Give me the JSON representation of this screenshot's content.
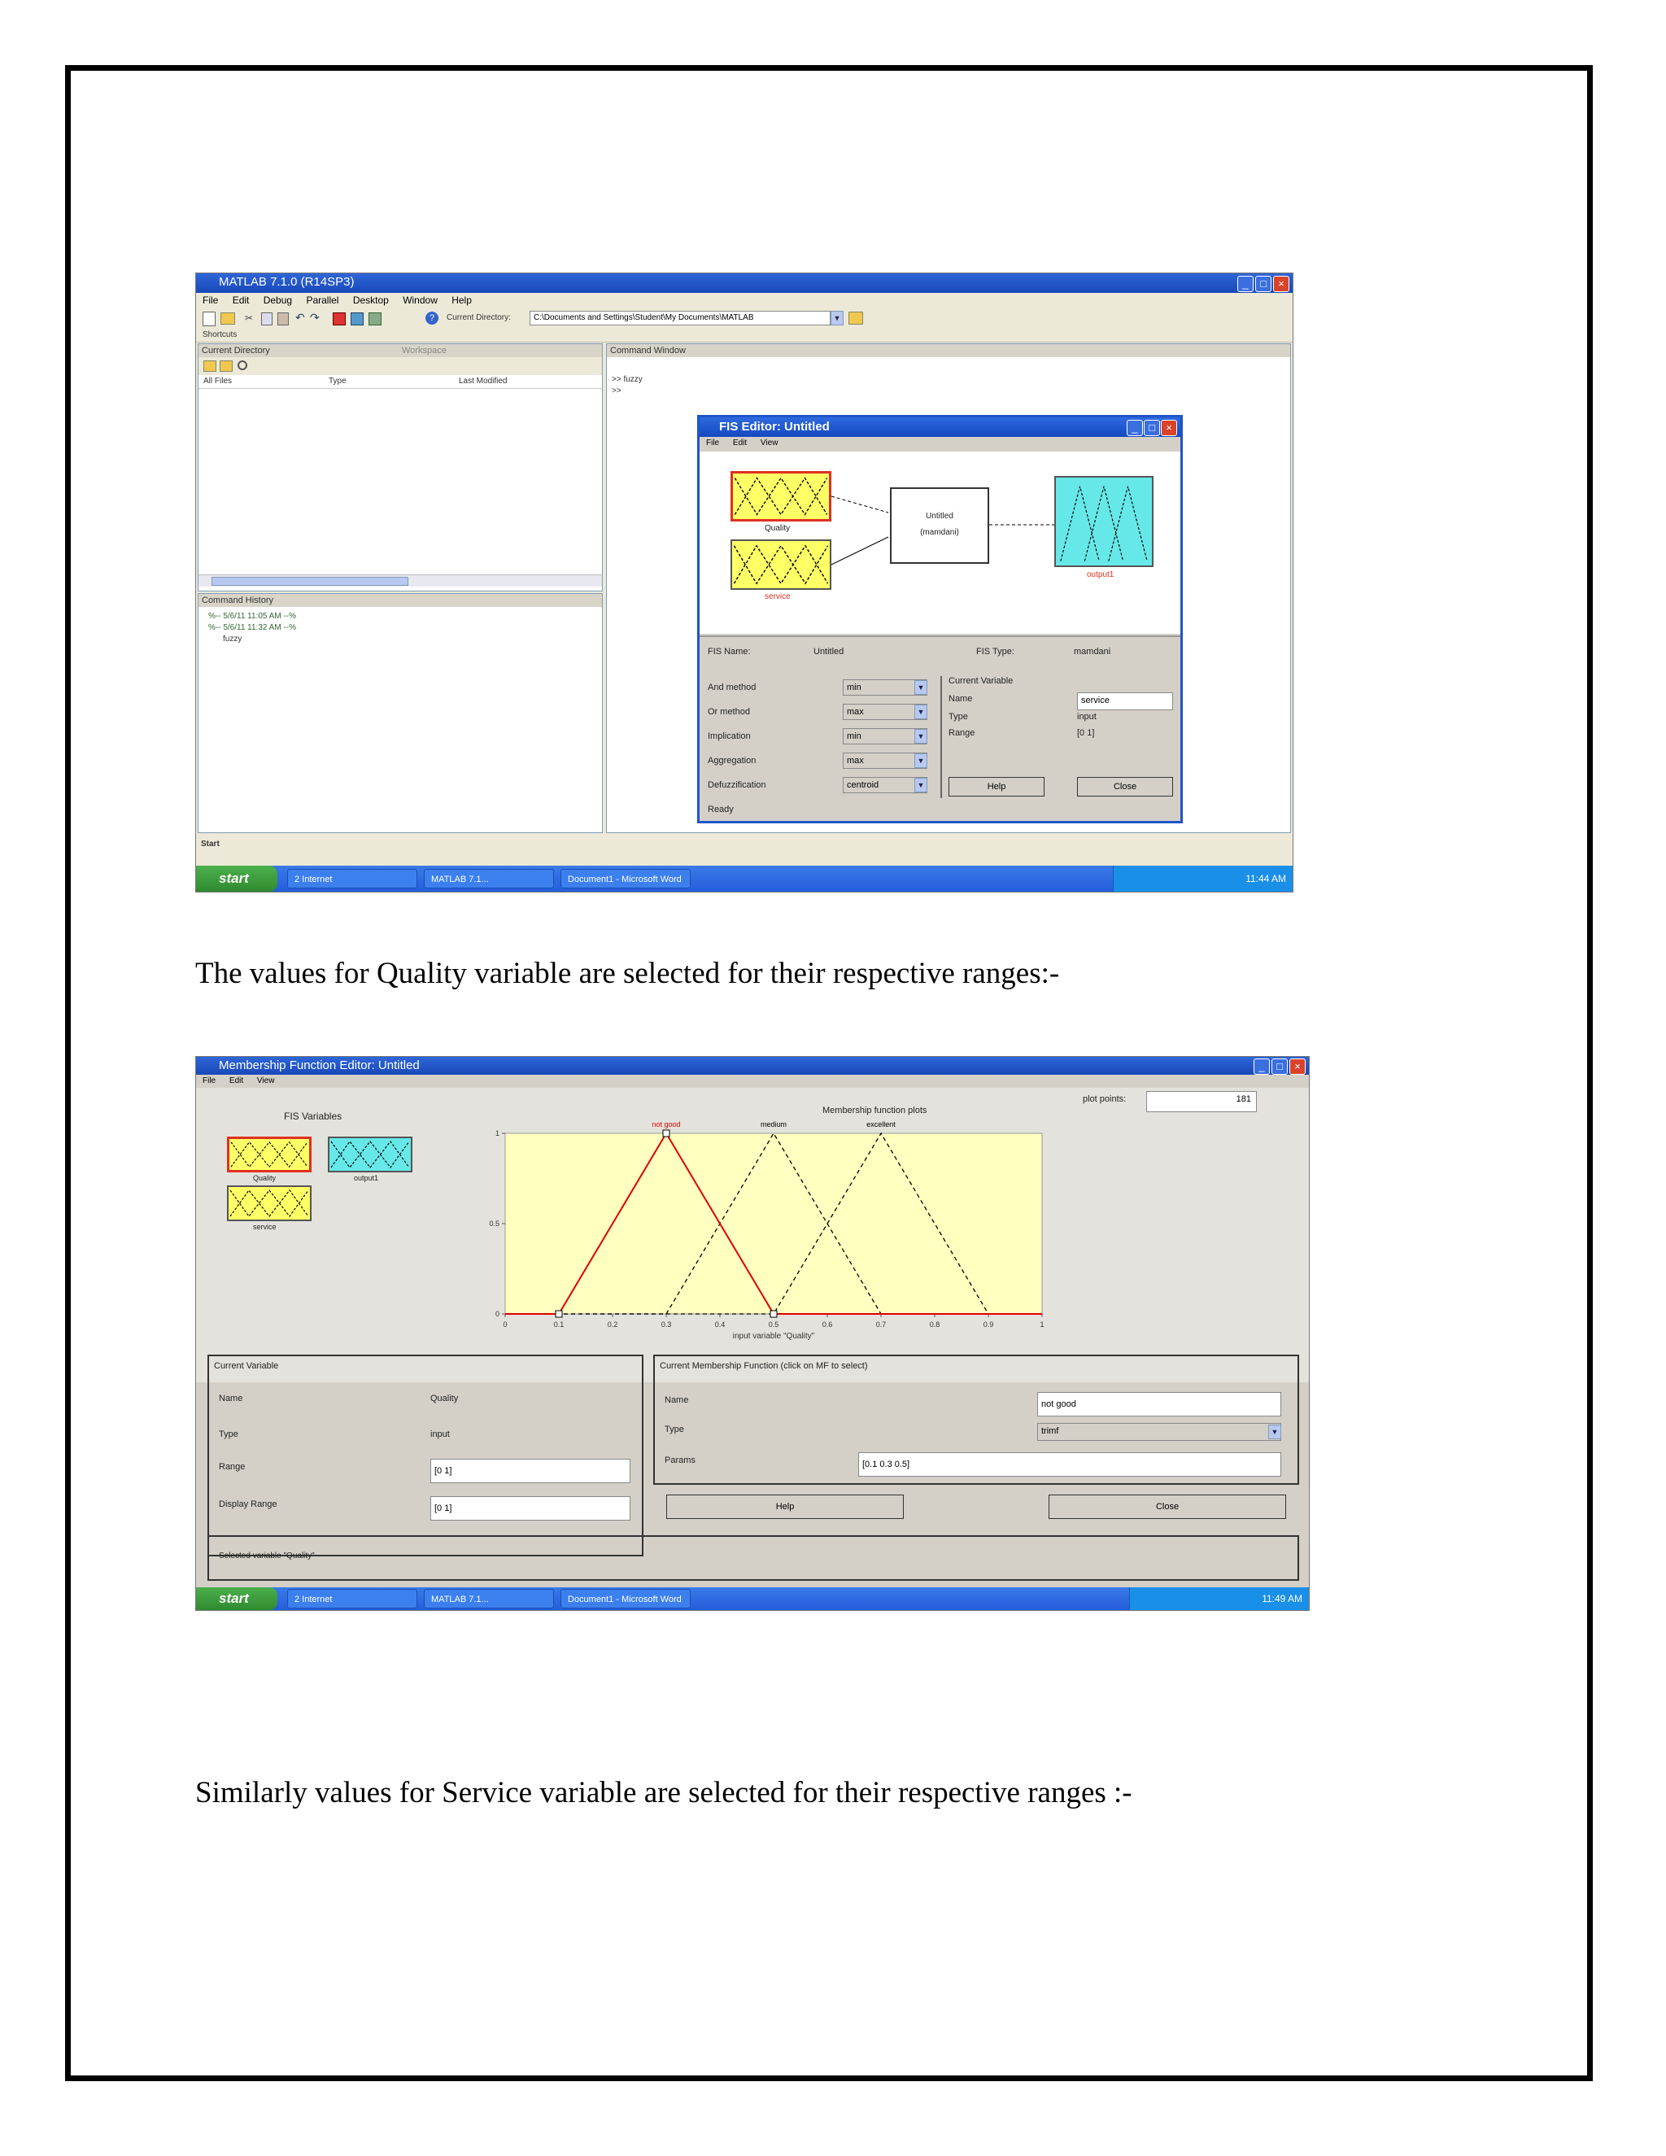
{
  "doc": {
    "caption1": "The values for Quality variable are selected for their respective ranges:-",
    "caption2": "Similarly values for Service variable are selected for their respective ranges :-"
  },
  "screenshot1": {
    "title": "MATLAB 7.1.0 (R14SP3)",
    "menu": [
      "File",
      "Edit",
      "Debug",
      "Parallel",
      "Desktop",
      "Window",
      "Help"
    ],
    "current_directory_label": "Current Directory:",
    "current_directory_path": "C:\\Documents and Settings\\Student\\My Documents\\MATLAB",
    "shortcuts_label": "Shortcuts",
    "panels": {
      "current_directory": "Current Directory",
      "workspace": "Workspace",
      "command_window": "Command Window",
      "command_history": "Command History"
    },
    "command_window_lines": [
      ">> fuzzy",
      ">>"
    ],
    "command_history_lines": [
      "%-- 5/6/11 11:05 AM --%",
      "%-- 5/6/11 11:32 AM --%",
      "fuzzy"
    ],
    "file_columns": [
      "All Files",
      "Type",
      "Last Modified"
    ],
    "status": "Start",
    "fis_editor": {
      "title": "FIS Editor: Untitled",
      "menu": [
        "File",
        "Edit",
        "View"
      ],
      "input1_label": "Quality",
      "input2_label": "service",
      "system_label_line1": "Untitled",
      "system_label_line2": "(mamdani)",
      "output_label": "output1",
      "fis_name_label": "FIS Name:",
      "fis_name_value": "Untitled",
      "fis_type_label": "FIS Type:",
      "fis_type_value": "mamdani",
      "rows": [
        {
          "label": "And method",
          "value": "min"
        },
        {
          "label": "Or method",
          "value": "max"
        },
        {
          "label": "Implication",
          "value": "min"
        },
        {
          "label": "Aggregation",
          "value": "max"
        },
        {
          "label": "Defuzzification",
          "value": "centroid"
        }
      ],
      "current_variable_label": "Current Variable",
      "cv_name_label": "Name",
      "cv_name_value": "service",
      "cv_type_label": "Type",
      "cv_type_value": "input",
      "cv_range_label": "Range",
      "cv_range_value": "[0 1]",
      "help_button": "Help",
      "close_button": "Close",
      "status": "Ready"
    },
    "taskbar": {
      "start": "start",
      "tasks": [
        "2 Internet",
        "MATLAB 7.1...",
        "Document1 - Microsoft Word"
      ],
      "clock": "11:44 AM"
    }
  },
  "screenshot2": {
    "title": "Membership Function Editor: Untitled",
    "menu": [
      "File",
      "Edit",
      "View"
    ],
    "fis_variables_label": "FIS Variables",
    "var_labels": [
      "Quality",
      "service",
      "output1"
    ],
    "plot_title": "Membership function plots",
    "plot_points_label": "plot points:",
    "plot_points_value": "181",
    "chart_data": {
      "type": "line",
      "xlabel": "input variable \"Quality\"",
      "xlim": [
        0,
        1
      ],
      "ylim": [
        0,
        1
      ],
      "x_ticks": [
        "0",
        "0.1",
        "0.2",
        "0.3",
        "0.4",
        "0.5",
        "0.6",
        "0.7",
        "0.8",
        "0.9",
        "1"
      ],
      "y_ticks": [
        "0",
        "0.5",
        "1"
      ],
      "series": [
        {
          "name": "not good",
          "x": [
            0,
            0.1,
            0.3,
            0.5,
            1
          ],
          "y": [
            0,
            0,
            1,
            0,
            0
          ],
          "color": "#e00000",
          "style": "solid"
        },
        {
          "name": "medium",
          "x": [
            0,
            0.3,
            0.5,
            0.7,
            1
          ],
          "y": [
            0,
            0,
            1,
            0,
            0
          ],
          "color": "#000000",
          "style": "dashed"
        },
        {
          "name": "excellent",
          "x": [
            0,
            0.5,
            0.7,
            0.9,
            1
          ],
          "y": [
            0,
            0,
            1,
            0,
            0
          ],
          "color": "#000000",
          "style": "dashed"
        }
      ]
    },
    "current_variable": {
      "title": "Current Variable",
      "name_label": "Name",
      "name_value": "Quality",
      "type_label": "Type",
      "type_value": "input",
      "range_label": "Range",
      "range_value": "[0 1]",
      "display_range_label": "Display Range",
      "display_range_value": "[0 1]"
    },
    "current_mf": {
      "title": "Current Membership Function (click on MF to select)",
      "name_label": "Name",
      "name_value": "not good",
      "type_label": "Type",
      "type_value": "trimf",
      "params_label": "Params",
      "params_value": "[0.1 0.3 0.5]"
    },
    "help_button": "Help",
    "close_button": "Close",
    "status": "Selected variable \"Quality\"",
    "taskbar": {
      "start": "start",
      "tasks": [
        "2 Internet",
        "MATLAB 7.1...",
        "Document1 - Microsoft Word"
      ],
      "clock": "11:49 AM"
    }
  }
}
